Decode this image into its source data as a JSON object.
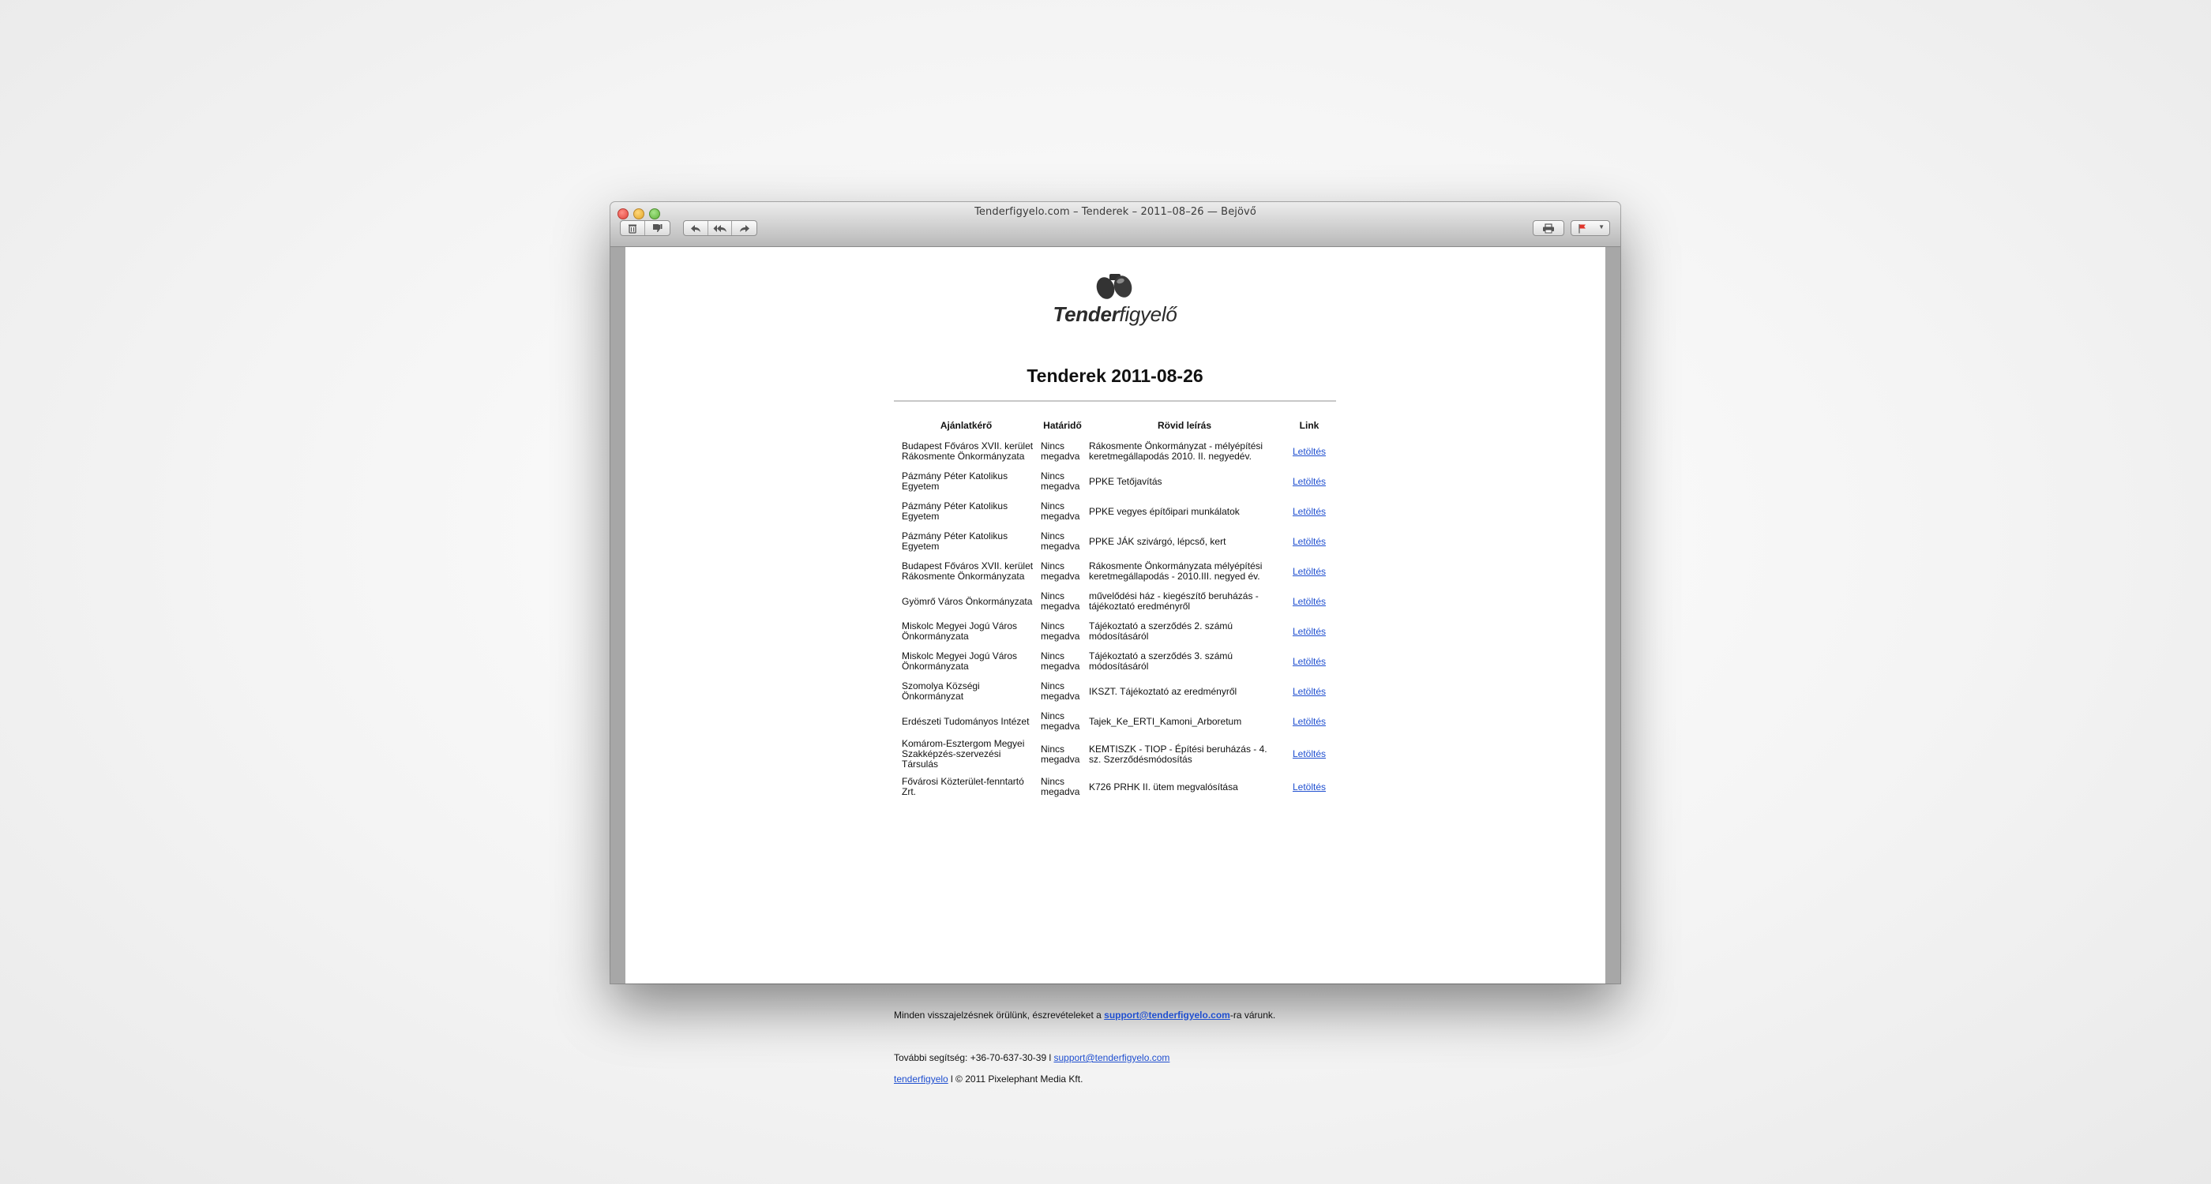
{
  "window": {
    "title": "Tenderfigyelo.com – Tenderek – 2011–08–26 — Bejövő"
  },
  "toolbar": {
    "delete_icon": "trash-icon",
    "junk_icon": "thumbs-down-icon",
    "reply_icon": "reply-arrow-icon",
    "reply_all_icon": "reply-all-arrow-icon",
    "forward_icon": "forward-arrow-icon",
    "print_icon": "printer-icon",
    "flag_icon": "red-flag-icon"
  },
  "logo": {
    "bold": "Tender",
    "rest": "figyelő"
  },
  "headline": "Tenderek 2011-08-26",
  "table": {
    "headers": [
      "Ajánlatkérő",
      "Határidő",
      "Rövid leírás",
      "Link"
    ],
    "rows": [
      {
        "ajanlatkero": "Budapest Főváros XVII. kerület Rákosmente Önkormányzata",
        "hatarido": "Nincs megadva",
        "leiras": "Rákosmente Önkormányzat - mélyépítési keretmegállapodás 2010. II. negyedév.",
        "link": "Letöltés"
      },
      {
        "ajanlatkero": "Pázmány Péter Katolikus Egyetem",
        "hatarido": "Nincs megadva",
        "leiras": "PPKE Tetőjavítás",
        "link": "Letöltés"
      },
      {
        "ajanlatkero": "Pázmány Péter Katolikus Egyetem",
        "hatarido": "Nincs megadva",
        "leiras": "PPKE vegyes építőipari munkálatok",
        "link": "Letöltés"
      },
      {
        "ajanlatkero": "Pázmány Péter Katolikus Egyetem",
        "hatarido": "Nincs megadva",
        "leiras": "PPKE JÁK szivárgó, lépcső, kert",
        "link": "Letöltés"
      },
      {
        "ajanlatkero": "Budapest Főváros XVII. kerület Rákosmente Önkormányzata",
        "hatarido": "Nincs megadva",
        "leiras": "Rákosmente Önkormányzata mélyépítési keretmegállapodás - 2010.III. negyed év.",
        "link": "Letöltés"
      },
      {
        "ajanlatkero": "Gyömrő Város Önkormányzata",
        "hatarido": "Nincs megadva",
        "leiras": "művelődési ház - kiegészítő beruházás - tájékoztató eredményről",
        "link": "Letöltés"
      },
      {
        "ajanlatkero": "Miskolc Megyei Jogú Város Önkormányzata",
        "hatarido": "Nincs megadva",
        "leiras": "Tájékoztató a szerződés 2. számú módosításáról",
        "link": "Letöltés"
      },
      {
        "ajanlatkero": "Miskolc Megyei Jogú Város Önkormányzata",
        "hatarido": "Nincs megadva",
        "leiras": "Tájékoztató a szerződés 3. számú módosításáról",
        "link": "Letöltés"
      },
      {
        "ajanlatkero": "Szomolya Községi Önkormányzat",
        "hatarido": "Nincs megadva",
        "leiras": "IKSZT. Tájékoztató az eredményről",
        "link": "Letöltés"
      },
      {
        "ajanlatkero": "Erdészeti Tudományos Intézet",
        "hatarido": "Nincs megadva",
        "leiras": "Tajek_Ke_ERTI_Kamoni_Arboretum",
        "link": "Letöltés"
      },
      {
        "ajanlatkero": "Komárom-Esztergom Megyei Szakképzés-szervezési Társulás",
        "hatarido": "Nincs megadva",
        "leiras": "KEMTISZK - TIOP - Építési beruházás - 4. sz. Szerződésmódosítás",
        "link": "Letöltés"
      },
      {
        "ajanlatkero": "Fővárosi Közterület-fenntartó Zrt.",
        "hatarido": "Nincs megadva",
        "leiras": "K726 PRHK II. ütem megvalósítása",
        "link": "Letöltés"
      }
    ]
  },
  "footer": {
    "feedback_before": "Minden visszajelzésnek örülünk, észrevételeket a ",
    "feedback_email": "support@tenderfigyelo.com",
    "feedback_after": "-ra várunk.",
    "help_before": "További segítség: +36-70-637-30-39 l ",
    "help_email": "support@tenderfigyelo.com",
    "site_link": "tenderfigyelo",
    "copyright": " l © 2011 Pixelephant Media Kft."
  }
}
